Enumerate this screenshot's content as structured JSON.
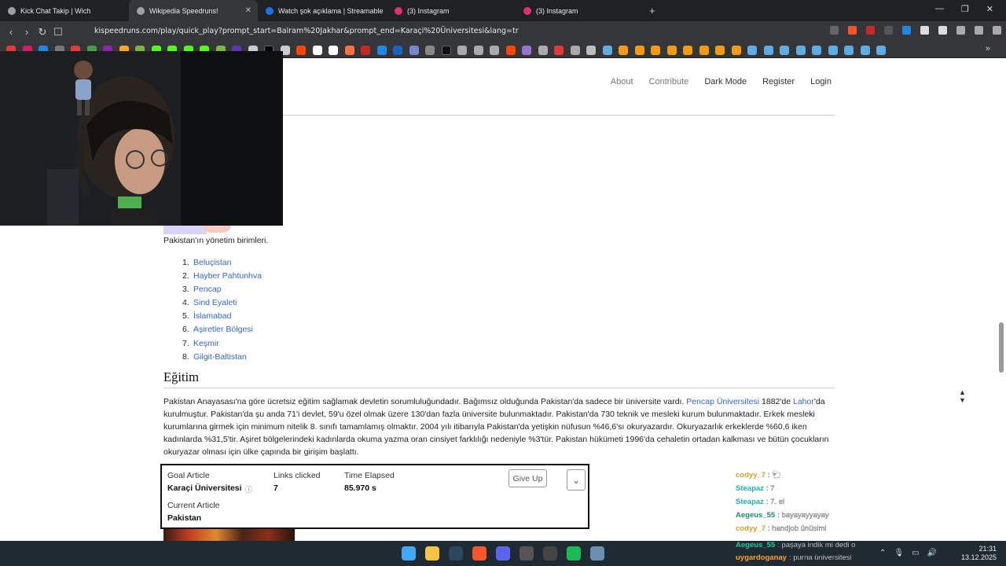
{
  "browser": {
    "tabs": [
      {
        "label": "Kick Chat Takip | Wich",
        "icon": "kick-icon",
        "color": "#9aa0a6"
      },
      {
        "label": "Wikipedia Speedruns!",
        "icon": "wiki-icon",
        "color": "#9aa0a6",
        "active": true
      },
      {
        "label": "Watch şok açıklama | Streamable",
        "icon": "streamable-icon",
        "color": "#1a73e8"
      },
      {
        "label": "(3) Instagram",
        "icon": "instagram-icon",
        "color": "#e1306c"
      },
      {
        "label": "(3) Instagram",
        "icon": "instagram-icon",
        "color": "#e1306c"
      }
    ],
    "new_tab": "+",
    "url": "kispeedruns.com/play/quick_play?prompt_start=Balram%20Jakhar&prompt_end=Karaçi%20Üniversitesi&lang=tr",
    "back": "‹",
    "forward": "›",
    "reload": "↻",
    "bookmark_more": "»"
  },
  "site_nav": {
    "about": "About",
    "contribute": "Contribute",
    "dark_mode": "Dark Mode",
    "register": "Register",
    "login": "Login"
  },
  "article": {
    "caption": "Pakistan'ın yönetim birimleri.",
    "list": [
      {
        "n": "1.",
        "label": "Beluçistan"
      },
      {
        "n": "2.",
        "label": "Hayber Pahtunhva"
      },
      {
        "n": "3.",
        "label": "Pencap"
      },
      {
        "n": "4.",
        "label": "Sind Eyaleti"
      },
      {
        "n": "5.",
        "label": "İslamabad"
      },
      {
        "n": "6.",
        "label": "Aşiretler Bölgesi"
      },
      {
        "n": "7.",
        "label": "Keşmir"
      },
      {
        "n": "8.",
        "label": "Gilgit-Baltistan"
      }
    ],
    "section_title": "Eğitim",
    "para_a": "Pakistan Anayasası'na göre ücretsiz eğitim sağlamak devletin sorumluluğundadır. Bağımsız olduğunda Pakistan'da sadece bir üniversite vardı. ",
    "para_link1": "Pencap Üniversitesi",
    "para_b": " 1882'de ",
    "para_link2": "Lahor",
    "para_c": "'da kurulmuştur. Pakistan'da şu anda 71'i devlet, 59'u özel olmak üzere 130'dan fazla üniversite bulunmaktadır. Pakistan'da 730 teknik ve mesleki kurum bulunmaktadır. Erkek mesleki kurumlarına girmek için minimum nitelik 8. sınıfı tamamlamış olmaktır. 2004 yılı itibarıyla Pakistan'da yetişkin nüfusun %46,6'sı okuryazardır. Okuryazarlık erkeklerde %60,6 iken kadınlarda %31,5'tir. Aşiret bölgelerindeki kadınlarda okuma yazma oran cinsiyet farklılığı nedeniyle %3'tür. Pakistan hükümeti 1996'da cehaletin ortadan kalkması ve bütün çocukların okuryazar olması için ülke çapında bir girişim başlattı."
  },
  "game_panel": {
    "goal_label": "Goal Article",
    "goal_value": "Karaçi Üniversitesi",
    "links_label": "Links clicked",
    "links_value": "7",
    "time_label": "Time Elapsed",
    "time_value": "85.970 s",
    "current_label": "Current Article",
    "current_value": "Pakistan",
    "give_up": "Give Up",
    "expand": "⌄",
    "info_icon": "ⓘ"
  },
  "chat": [
    {
      "user": "codyy_7",
      "msg": ": 🐑",
      "color": "#c9a227"
    },
    {
      "user": "Steapaz",
      "msg": ": 7",
      "color": "#20b2aa"
    },
    {
      "user": "Steapaz",
      "msg": ": 7. el",
      "color": "#20b2aa"
    },
    {
      "user": "Aegeus_55",
      "msg": ": bayayayyayay",
      "color": "#20c997"
    },
    {
      "user": "codyy_7",
      "msg": ": handjob ünüsimi",
      "color": "#c9a227"
    }
  ],
  "chat_bottom": [
    {
      "user": "Aegeus_55",
      "msg": ": paşaya indik mi dedi o",
      "color": "#20c997"
    },
    {
      "user": "uygardoganay",
      "msg": ": purna üniversitesi",
      "color": "#f5a623"
    }
  ],
  "taskbar": {
    "time": "21:31",
    "date": "13.12.2025"
  },
  "colors": {
    "link": "#3366cc",
    "tab_bg": "#202124",
    "toolbar_bg": "#35363a",
    "taskbar_bg": "#1f2a33"
  }
}
